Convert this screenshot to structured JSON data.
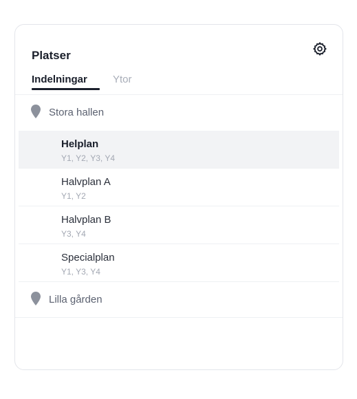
{
  "panel": {
    "title": "Platser",
    "tabs": [
      {
        "label": "Indelningar",
        "active": true
      },
      {
        "label": "Ytor",
        "active": false
      }
    ]
  },
  "locations": [
    {
      "name": "Stora hallen",
      "items": [
        {
          "name": "Helplan",
          "areas": "Y1, Y2, Y3, Y4",
          "selected": true
        },
        {
          "name": "Halvplan A",
          "areas": "Y1, Y2",
          "selected": false
        },
        {
          "name": "Halvplan B",
          "areas": "Y3, Y4",
          "selected": false
        },
        {
          "name": "Specialplan",
          "areas": "Y1, Y3, Y4",
          "selected": false
        }
      ]
    },
    {
      "name": "Lilla gården",
      "items": []
    }
  ],
  "icons": {
    "settings": "gear-icon",
    "location": "map-pin-icon"
  },
  "colors": {
    "selected_row_bg": "#f2f3f5",
    "pin": "#8c919c",
    "text": "#1a1f2b",
    "muted": "#a3a8b3"
  }
}
